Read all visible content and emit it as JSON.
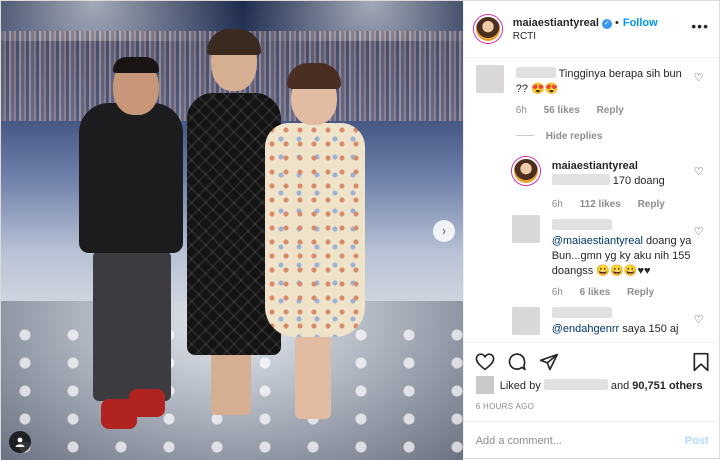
{
  "header": {
    "username": "maiaestiantyreal",
    "follow_label": "Follow",
    "location": "RCTI",
    "more_label": "•••"
  },
  "comments": [
    {
      "text": "Tingginya berapa sih bun ?? 😍😍",
      "time": "6h",
      "likes": "56 likes",
      "reply": "Reply"
    },
    {
      "hide_replies": "Hide replies"
    },
    {
      "username": "maiaestiantyreal",
      "text": "170 doang",
      "time": "6h",
      "likes": "112 likes",
      "reply": "Reply"
    },
    {
      "mention": "@maiaestiantyreal",
      "text": "doang ya Bun...gmn yg ky aku nih 155 doangss 😀😀😀♥♥",
      "time": "6h",
      "likes": "6 likes",
      "reply": "Reply"
    },
    {
      "mention": "@endahgenrr",
      "text": "saya 150 aj"
    }
  ],
  "likes": {
    "prefix": "Liked by",
    "and_label": "and",
    "count": "90,751 others"
  },
  "timestamp": "6 HOURS AGO",
  "add_comment": {
    "placeholder": "Add a comment...",
    "post_label": "Post"
  },
  "icons": {
    "heart": "heart-icon",
    "comment": "comment-icon",
    "share": "share-icon",
    "save": "bookmark-icon",
    "next": "chevron-right-icon",
    "tag": "user-tag-icon"
  },
  "colors": {
    "link_blue": "#0095f6",
    "mention": "#00376b",
    "muted": "#8e8e8e",
    "post_disabled": "#b3dbff"
  }
}
